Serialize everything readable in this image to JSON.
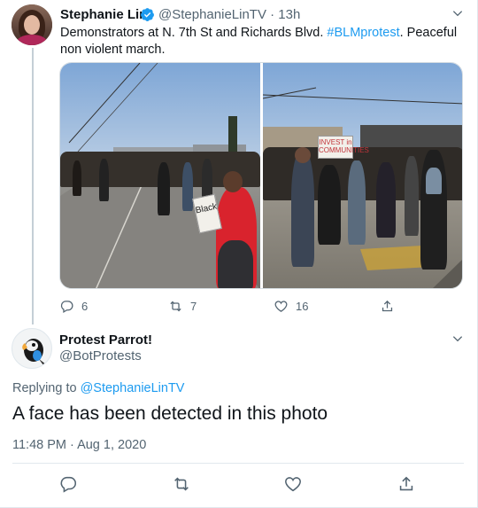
{
  "tweet1": {
    "name": "Stephanie Lin",
    "handle_time": "@StephanieLinTV · 13h",
    "text_before_hashtag": "Demonstrators at N. 7th St and Richards Blvd. ",
    "hashtag": "#BLMprotest",
    "text_after_hashtag": ". Peaceful non violent march.",
    "photo_sign_left": "Black",
    "photo_sign_right": "INVEST in COMMUNITIES",
    "reply_count": "6",
    "retweet_count": "7",
    "like_count": "16"
  },
  "tweet2": {
    "name": "Protest Parrot!",
    "handle": "@BotProtests",
    "replying_prefix": "Replying to ",
    "replying_to": "@StephanieLinTV",
    "text": "A face has been detected in this photo",
    "timestamp": "11:48 PM · Aug 1, 2020"
  },
  "colors": {
    "accent": "#1d9bf0",
    "muted": "#536471",
    "text": "#0f1419",
    "divider": "#e1e8ed"
  },
  "icons": {
    "verified": "verified-badge-icon",
    "more": "chevron-down-icon",
    "reply": "reply-icon",
    "retweet": "retweet-icon",
    "like": "heart-icon",
    "share": "share-icon"
  }
}
